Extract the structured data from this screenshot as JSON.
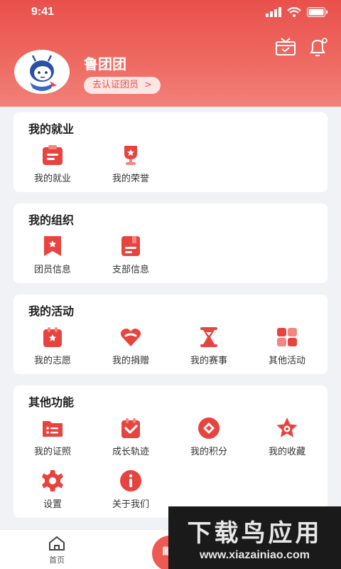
{
  "status": {
    "time": "9:41"
  },
  "profile": {
    "name": "鲁团团",
    "verify_label": "去认证团员",
    "verify_arrow": ">"
  },
  "header_icons": [
    "gift-box-icon",
    "notification-bell-icon"
  ],
  "sections": [
    {
      "title": "我的就业",
      "items": [
        {
          "label": "我的就业",
          "icon": "clipboard-icon"
        },
        {
          "label": "我的荣誉",
          "icon": "trophy-icon"
        }
      ]
    },
    {
      "title": "我的组织",
      "items": [
        {
          "label": "团员信息",
          "icon": "bookmark-star-icon"
        },
        {
          "label": "支部信息",
          "icon": "notebook-icon"
        }
      ]
    },
    {
      "title": "我的活动",
      "items": [
        {
          "label": "我的志愿",
          "icon": "calendar-star-icon"
        },
        {
          "label": "我的捐赠",
          "icon": "heart-icon"
        },
        {
          "label": "我的赛事",
          "icon": "hourglass-icon"
        },
        {
          "label": "其他活动",
          "icon": "grid-apps-icon"
        }
      ]
    },
    {
      "title": "其他功能",
      "items": [
        {
          "label": "我的证照",
          "icon": "id-card-icon"
        },
        {
          "label": "成长轨迹",
          "icon": "calendar-check-icon"
        },
        {
          "label": "我的积分",
          "icon": "diamond-coin-icon"
        },
        {
          "label": "我的收藏",
          "icon": "star-icon"
        },
        {
          "label": "设置",
          "icon": "gear-icon"
        },
        {
          "label": "关于我们",
          "icon": "info-icon"
        }
      ]
    }
  ],
  "tabbar": {
    "home_label": "首页"
  },
  "watermark": {
    "title": "下载鸟应用",
    "url": "www.xiazainiao.com"
  },
  "colors": {
    "accent": "#e9504c",
    "icon_red": "#e8443f",
    "background": "#f1f2f6"
  }
}
